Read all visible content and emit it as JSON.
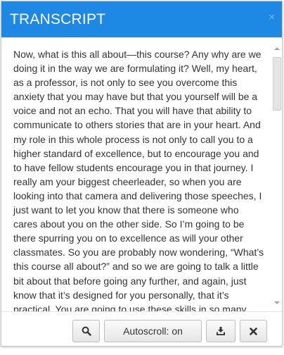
{
  "page": {
    "edge_glyph": ":"
  },
  "dialog": {
    "title": "TRANSCRIPT",
    "close_glyph": "×",
    "transcript": "Now, what is this all about—this course? Any why are we doing it in the way we are formulating it? Well, my heart, as a professor, is not only to see you overcome this anxiety that you may have but that you yourself will be a voice and not an echo. That you will have that ability to communicate to others stories that are in your heart. And my role in this whole process is not only to call you to a higher standard of excellence, but to encourage you and to have fellow students encourage you in that journey. I really am your biggest cheerleader, so when you are looking into that camera and delivering those speeches, I just want to let you know that there is someone who cares about you on the other side. So I’m going to be there spurring you on to excellence as will your other classmates. So you are probably now wondering, “What’s this course all about?” and so we are going to talk a little bit about that before going any further, and again, just know that it’s designed for you personally, that it’s practical. You are going to use these skills in so many different settings, not only professionally, but also personally. Maybe if you are invited to give a toast at a wedding or you are called on to give a speech"
  },
  "footer": {
    "search_icon": "magnifier",
    "autoscroll_label": "Autoscroll: on",
    "download_icon": "download-tray",
    "close_icon": "x"
  },
  "colors": {
    "header": "#1e88e5",
    "text": "#333333"
  }
}
